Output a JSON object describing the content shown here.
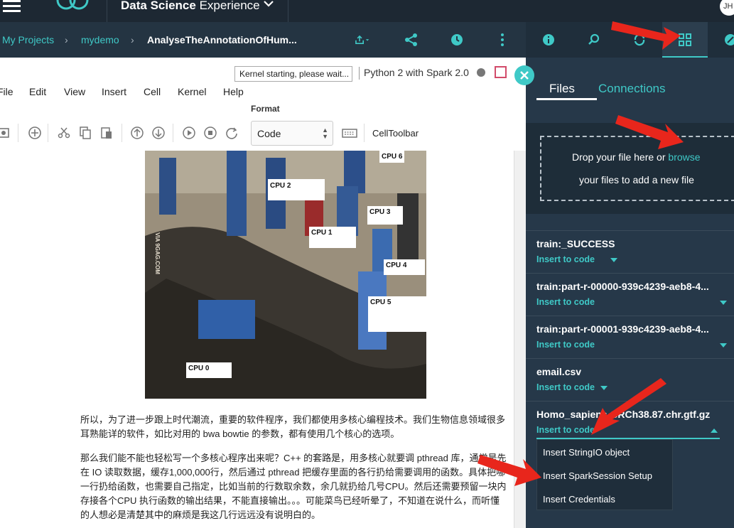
{
  "topbar": {
    "product_bold": "Data Science",
    "product_rest": " Experience",
    "avatar": "JH"
  },
  "breadcrumb": {
    "projects": "My Projects",
    "project": "mydemo",
    "notebook": "AnalyseTheAnnotationOfHum..."
  },
  "kernel": {
    "status": "Kernel starting, please wait...",
    "name": "Python 2 with Spark 2.0"
  },
  "menu": [
    "File",
    "Edit",
    "View",
    "Insert",
    "Cell",
    "Kernel",
    "Help"
  ],
  "toolbar": {
    "format_label": "Format",
    "cell_type": "Code",
    "celltoolbar": "CellToolbar"
  },
  "image": {
    "watermark": "VIA 9GAG.COM",
    "labels": [
      "CPU 0",
      "CPU 1",
      "CPU 2",
      "CPU 3",
      "CPU 4",
      "CPU 5",
      "CPU 6"
    ]
  },
  "text": {
    "para1": "所以，为了进一步跟上时代潮流，重要的软件程序，我们都使用多核心编程技术。我们生物信息领域很多耳熟能详的软件，如比对用的 bwa bowtie 的参数，都有使用几个核心的选项。",
    "para2": "那么我们能不能也轻松写一个多核心程序出来呢？C++ 的套路是，用多核心就要调 pthread 库，通常是先在 IO 读取数据，缓存1,000,000行，然后通过 pthread 把缓存里面的各行扔给需要调用的函数。具体把哪一行扔给函数，也需要自己指定，比如当前的行数取余数，余几就扔给几号CPU。然后还需要预留一块内存接各个CPU 执行函数的输出结果，不能直接输出。。。可能菜鸟已经听晕了，不知道在说什么，而听懂的人想必是清楚其中的麻烦是我这几行远远没有说明白的。"
  },
  "panel": {
    "tabs": {
      "files": "Files",
      "connections": "Connections"
    },
    "drop_text": "Drop your file here or ",
    "drop_link": "browse",
    "drop_text2": "your files to add a new file",
    "files": [
      {
        "name": "train:_SUCCESS",
        "action": "Insert to code"
      },
      {
        "name": "train:part-r-00000-939c4239-aeb8-4...",
        "action": "Insert to code"
      },
      {
        "name": "train:part-r-00001-939c4239-aeb8-4...",
        "action": "Insert to code"
      },
      {
        "name": "email.csv",
        "action": "Insert to code"
      },
      {
        "name": "Homo_sapiens.GRCh38.87.chr.gtf.gz",
        "action": "Insert to code"
      }
    ],
    "dropdown": [
      "Insert StringIO object",
      "Insert SparkSession Setup",
      "Insert Credentials"
    ]
  },
  "colors": {
    "accent": "#3fc9c7",
    "dark": "#1d2833",
    "panel": "#263849",
    "arrow": "#e8261c"
  }
}
